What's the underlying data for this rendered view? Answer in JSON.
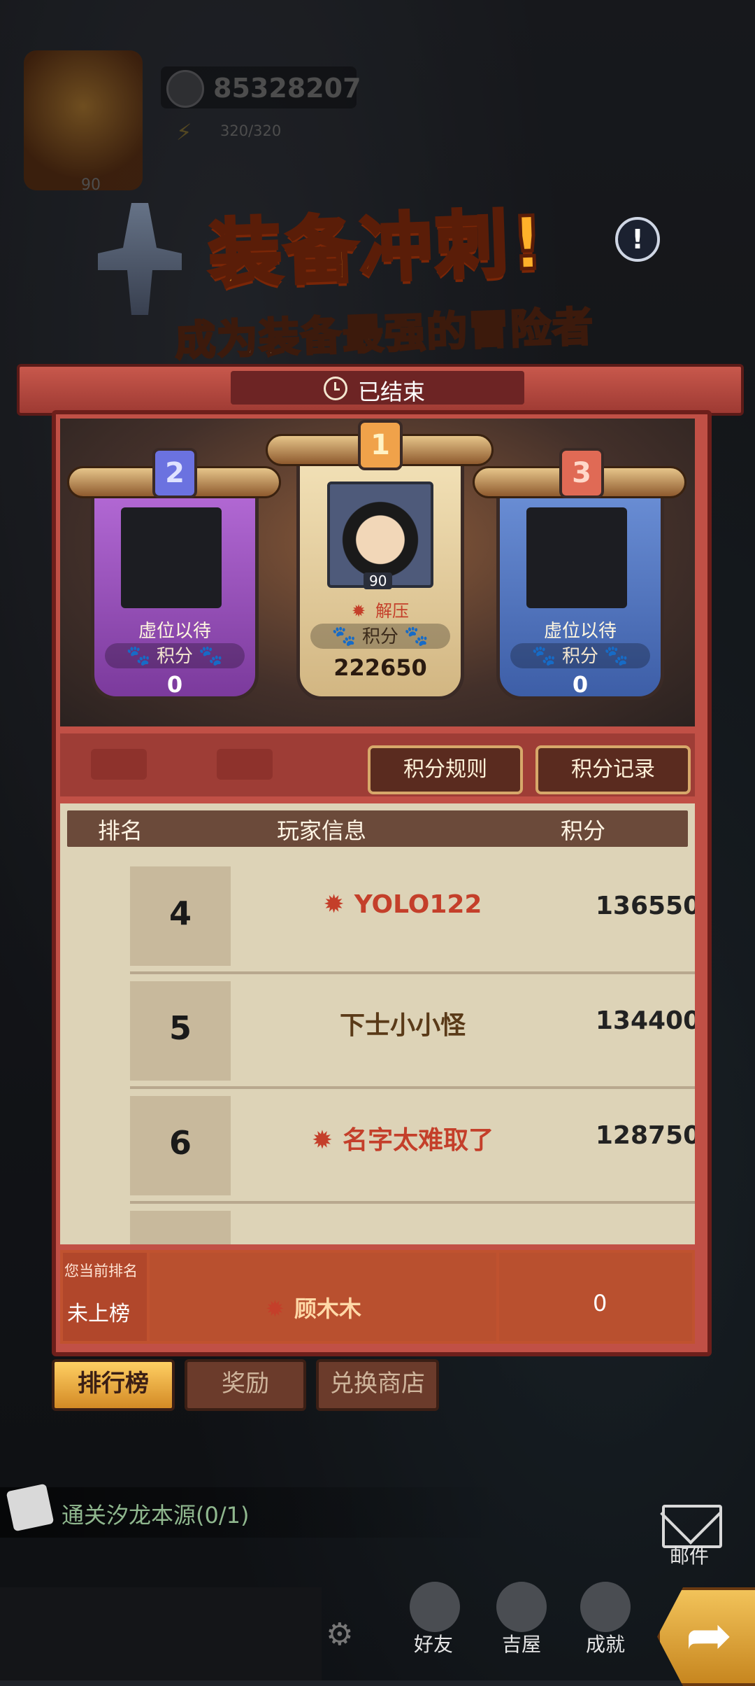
{
  "hud": {
    "power": "85328207",
    "energy": "320/320",
    "level": "90"
  },
  "event": {
    "title": "装备冲刺!",
    "subtitle": "成为装备最强的冒险者",
    "status": "已结束"
  },
  "podium": [
    {
      "rank": "2",
      "name": "虚位以待",
      "score_label": "积分",
      "score": "0"
    },
    {
      "rank": "1",
      "name": "解压",
      "level": "90",
      "score_label": "积分",
      "score": "222650"
    },
    {
      "rank": "3",
      "name": "虚位以待",
      "score_label": "积分",
      "score": "0"
    }
  ],
  "buttons": {
    "rules": "积分规则",
    "records": "积分记录"
  },
  "table": {
    "headers": {
      "rank": "排名",
      "player": "玩家信息",
      "score": "积分"
    },
    "rows": [
      {
        "rank": "4",
        "name": "YOLO122",
        "score": "136550"
      },
      {
        "rank": "5",
        "name": "下士小小怪",
        "score": "134400"
      },
      {
        "rank": "6",
        "name": "名字太难取了",
        "score": "128750"
      }
    ]
  },
  "my_rank": {
    "label": "您当前排名",
    "rank": "未上榜",
    "name": "顾木木",
    "score": "0"
  },
  "tabs": [
    "排行榜",
    "奖励",
    "兑换商店"
  ],
  "quest": {
    "text": "通关汐龙本源(0/1)"
  },
  "nav": {
    "mail": "邮件",
    "friends": "好友",
    "house": "吉屋",
    "achievements": "成就"
  }
}
